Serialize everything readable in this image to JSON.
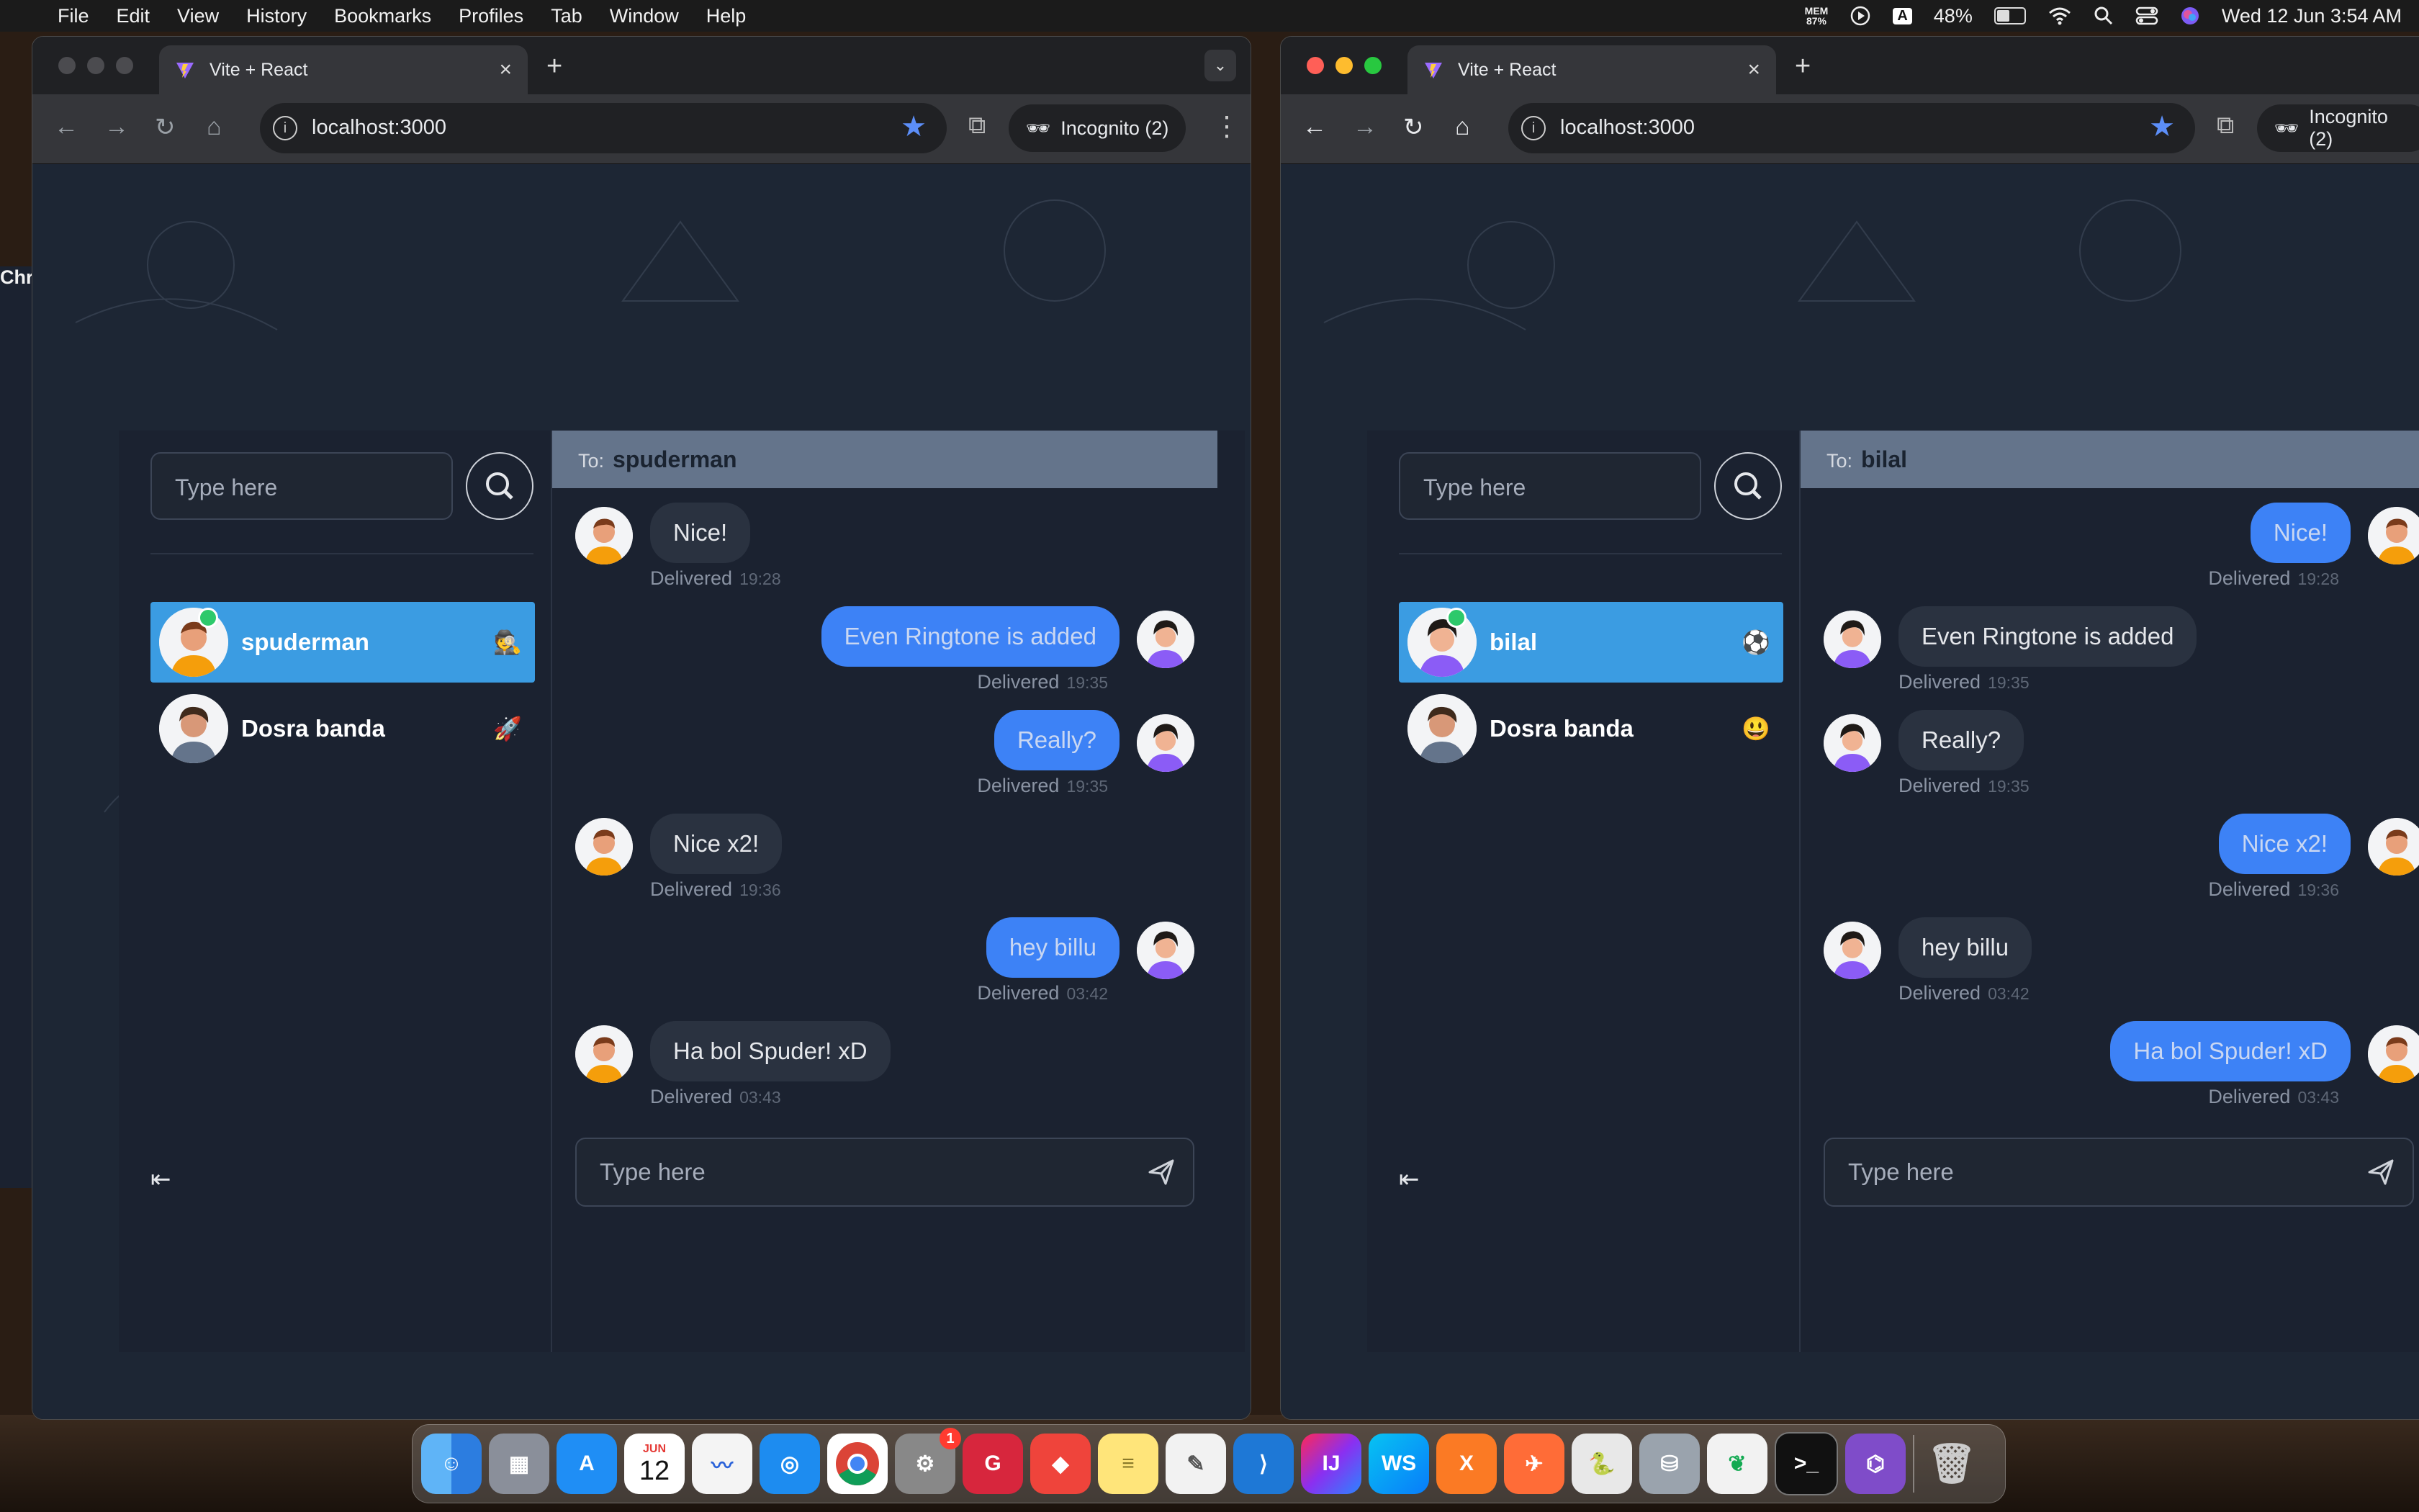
{
  "menubar": {
    "app_name": "Chrome",
    "menus": [
      "File",
      "Edit",
      "View",
      "History",
      "Bookmarks",
      "Profiles",
      "Tab",
      "Window",
      "Help"
    ],
    "mem_label": "MEM",
    "mem_value": "87%",
    "input_source": "A",
    "battery": "48%",
    "datetime": "Wed 12 Jun  3:54 AM"
  },
  "windows": [
    {
      "tab_title": "Vite + React",
      "url": "localhost:3000",
      "incognito_label": "Incognito (2)",
      "search_placeholder": "Type here",
      "contacts": [
        {
          "name": "spuderman",
          "emoji": "🕵️",
          "active": true,
          "online": true
        },
        {
          "name": "Dosra banda",
          "emoji": "🚀",
          "active": false,
          "online": false
        }
      ],
      "chat": {
        "to_label": "To:",
        "recipient": "spuderman",
        "messages": [
          {
            "text": "Nice!",
            "status": "Delivered",
            "time": "19:28",
            "outgoing": false
          },
          {
            "text": "Even Ringtone is added",
            "status": "Delivered",
            "time": "19:35",
            "outgoing": true
          },
          {
            "text": "Really?",
            "status": "Delivered",
            "time": "19:35",
            "outgoing": true
          },
          {
            "text": "Nice x2!",
            "status": "Delivered",
            "time": "19:36",
            "outgoing": false
          },
          {
            "text": "hey billu",
            "status": "Delivered",
            "time": "03:42",
            "outgoing": true
          },
          {
            "text": "Ha bol Spuder! xD",
            "status": "Delivered",
            "time": "03:43",
            "outgoing": false
          }
        ],
        "input_placeholder": "Type here"
      }
    },
    {
      "tab_title": "Vite + React",
      "url": "localhost:3000",
      "incognito_label": "Incognito (2)",
      "search_placeholder": "Type here",
      "contacts": [
        {
          "name": "bilal",
          "emoji": "⚽",
          "active": true,
          "online": true
        },
        {
          "name": "Dosra banda",
          "emoji": "😃",
          "active": false,
          "online": false
        }
      ],
      "chat": {
        "to_label": "To:",
        "recipient": "bilal",
        "messages": [
          {
            "text": "Nice!",
            "status": "Delivered",
            "time": "19:28",
            "outgoing": true
          },
          {
            "text": "Even Ringtone is added",
            "status": "Delivered",
            "time": "19:35",
            "outgoing": false
          },
          {
            "text": "Really?",
            "status": "Delivered",
            "time": "19:35",
            "outgoing": false
          },
          {
            "text": "Nice x2!",
            "status": "Delivered",
            "time": "19:36",
            "outgoing": true
          },
          {
            "text": "hey billu",
            "status": "Delivered",
            "time": "03:42",
            "outgoing": false
          },
          {
            "text": "Ha bol Spuder! xD",
            "status": "Delivered",
            "time": "03:43",
            "outgoing": true
          }
        ],
        "input_placeholder": "Type here"
      }
    }
  ],
  "dock": {
    "calendar_month": "JUN",
    "calendar_day": "12",
    "settings_badge": "1",
    "apps": [
      "finder-icon",
      "launchpad-icon",
      "app-store-icon",
      "calendar-icon",
      "freeform-icon",
      "safari-icon",
      "chrome-icon",
      "system-settings-icon",
      "vpn-icon",
      "anydesk-icon",
      "notes-icon",
      "textedit-icon",
      "vscode-icon",
      "intellij-icon",
      "webstorm-icon",
      "xampp-icon",
      "postman-icon",
      "python-icon",
      "disk-utility-icon",
      "mongodb-compass-icon",
      "terminal-icon",
      "github-desktop-icon",
      "trash-icon"
    ]
  },
  "colors": {
    "accent_blue": "#3d82f6",
    "contact_active": "#3b9ce2",
    "chat_header": "#64748b",
    "online_dot": "#2dc96b"
  }
}
